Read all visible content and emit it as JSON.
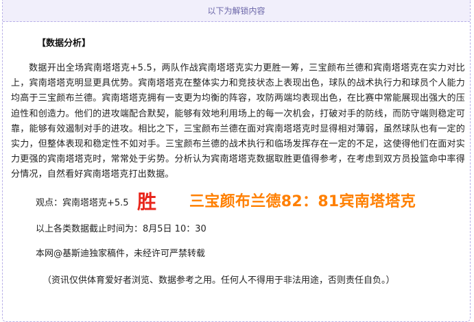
{
  "banner": {
    "text": "以下为解锁内容"
  },
  "article": {
    "heading": "【数据分析】",
    "paragraph": "数据开出全场宾南塔塔克+5.5，两队作战宾南塔塔克实力更胜一筹，三宝颜布兰德和宾南塔塔克在实力对比上，宾南塔塔克明显更具优势。宾南塔塔克在整体实力和竞技状态上表现出色，球队的战术执行力和球员个人能力均高于三宝颜布兰德。宾南塔塔克拥有一支更为均衡的阵容，攻防两端均表现出色，在比赛中常能展现出强大的压迫性和创造力。他们的进攻端配合默契，能够有效地利用场上的每一次机会，打破对手的防线，而防守端则稳定可靠，能够有效遏制对手的进攻。相比之下，三宝颜布兰德在面对宾南塔塔克时显得相对薄弱，虽然球队也有一定的实力，但整体表现和稳定性不如对手。三宝颜布兰德的战术执行和临场发挥存在一定的不足，这使得他们在面对实力更强的宾南塔塔克时，常常处于劣势。分析认为宾南塔塔克数据取胜更值得参考，在考虑到双方员投篮命中率得分情况，自然看好宾南塔塔克打出数据。",
    "opinion_label": "观点：宾南塔塔克+5.5",
    "opinion_result": "胜",
    "opinion_score": "三宝颜布兰德82：81宾南塔塔克",
    "data_time": "以上各类数据截止时间为：8月5日 10：30",
    "copyright": "本网@基斯迪独家稿件，未经许可严禁转载",
    "disclaimer": "（资讯仅供体育爱好者浏览、数据参考之用。任何人不得用于非法用途，否则责任自负。）"
  },
  "colors": {
    "banner_bg": "#f1effb",
    "banner_text": "#6b66a8",
    "border": "#b7aee8",
    "result_red": "#e8261c",
    "score_orange": "#ff7f00"
  }
}
